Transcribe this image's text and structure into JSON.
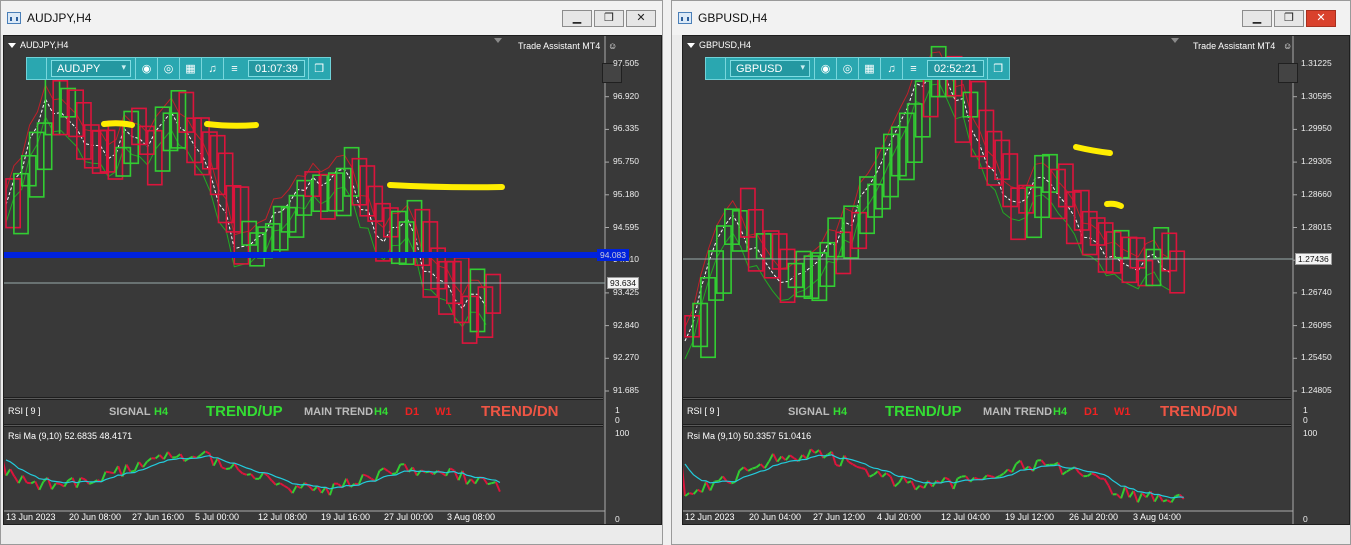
{
  "windows": [
    {
      "id": "audjpy",
      "title": "AUDJPY,H4",
      "chart_label": "AUDJPY,H4",
      "trade_assistant": "Trade Assistant MT4",
      "toolbar": {
        "symbol": "AUDJPY",
        "timer": "01:07:39"
      },
      "price_labels": [
        "97.505",
        "96.920",
        "96.335",
        "95.750",
        "95.180",
        "94.595",
        "94.010",
        "93.425",
        "92.840",
        "92.270",
        "91.685"
      ],
      "current_price": "93.634",
      "level_price": "94.083",
      "signal": {
        "rsi_label": "RSI [ 9 ]",
        "signal_label": "SIGNAL",
        "signal_tf": "H4",
        "signal_trend": "TREND/UP",
        "main_label": "MAIN TREND",
        "main_h4": "H4",
        "main_d1": "D1",
        "main_w1": "W1",
        "main_trend": "TREND/DN",
        "scale_top": "1",
        "scale_bottom": "0"
      },
      "rsi": {
        "title": "Rsi Ma (9,10) 52.6835 48.4171",
        "scale_top": "100",
        "scale_bottom": "0"
      },
      "time_labels": [
        "13 Jun 2023",
        "20 Jun 08:00",
        "27 Jun 16:00",
        "5 Jul 00:00",
        "12 Jul 08:00",
        "19 Jul 16:00",
        "27 Jul 00:00",
        "3 Aug 08:00"
      ],
      "colors": {
        "bull": "#32cd32",
        "bear": "#dc143c",
        "level": "#0022dd",
        "marker": "#ffee00",
        "rsi_ma": "#22ccdd"
      }
    },
    {
      "id": "gbpusd",
      "title": "GBPUSD,H4",
      "chart_label": "GBPUSD,H4",
      "trade_assistant": "Trade Assistant MT4",
      "toolbar": {
        "symbol": "GBPUSD",
        "timer": "02:52:21"
      },
      "price_labels": [
        "1.31225",
        "1.30595",
        "1.29950",
        "1.29305",
        "1.28660",
        "1.28015",
        "1.27436",
        "1.26740",
        "1.26095",
        "1.25450",
        "1.24805"
      ],
      "current_price": "1.27436",
      "level_price": "",
      "signal": {
        "rsi_label": "RSI [ 9 ]",
        "signal_label": "SIGNAL",
        "signal_tf": "H4",
        "signal_trend": "TREND/UP",
        "main_label": "MAIN TREND",
        "main_h4": "H4",
        "main_d1": "D1",
        "main_w1": "W1",
        "main_trend": "TREND/DN",
        "scale_top": "1",
        "scale_bottom": "0"
      },
      "rsi": {
        "title": "Rsi Ma (9,10) 50.3357 51.0416",
        "scale_top": "100",
        "scale_bottom": "0"
      },
      "time_labels": [
        "12 Jun 2023",
        "20 Jun 04:00",
        "27 Jun 12:00",
        "4 Jul 20:00",
        "12 Jul 04:00",
        "19 Jul 12:00",
        "26 Jul 20:00",
        "3 Aug 04:00"
      ],
      "colors": {
        "bull": "#32cd32",
        "bear": "#dc143c",
        "level": "#0022dd",
        "marker": "#ffee00",
        "rsi_ma": "#22ccdd"
      }
    }
  ],
  "window_controls": {
    "minimize": "▁",
    "restore": "❐",
    "close": "✕"
  },
  "toolbar_icons": [
    "camera-icon",
    "eye-icon",
    "calendar-icon",
    "bell-icon",
    "menu-icon",
    "window-icon"
  ]
}
